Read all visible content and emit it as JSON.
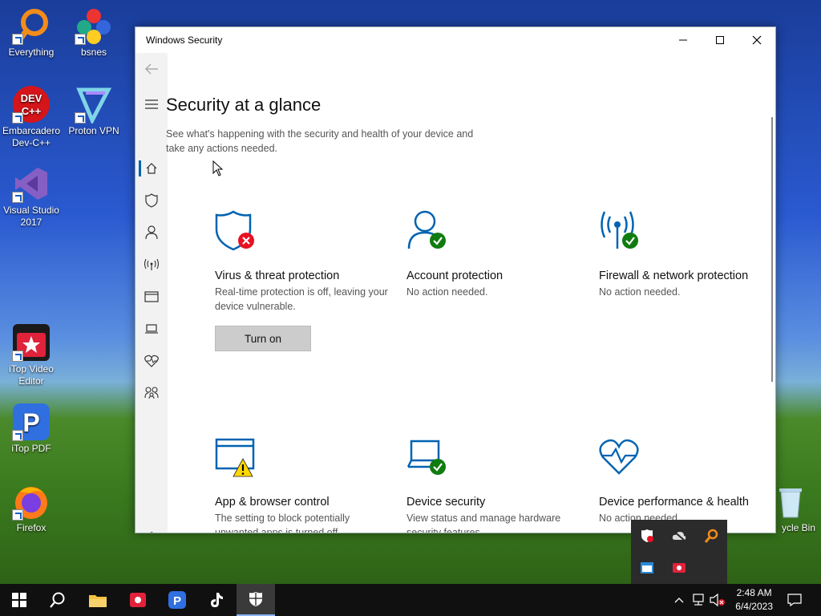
{
  "desktop": {
    "icons": [
      {
        "label": "Everything"
      },
      {
        "label": "bsnes"
      },
      {
        "label": "Embarcadero Dev-C++",
        "badge": "DEV C++"
      },
      {
        "label": "Proton VPN"
      },
      {
        "label": "Visual Studio 2017"
      },
      {
        "label": "iTop Video Editor"
      },
      {
        "label": "iTop PDF"
      },
      {
        "label": "Firefox"
      },
      {
        "label": "Recycle Bin",
        "visible": "ycle Bin"
      }
    ]
  },
  "window": {
    "title": "Windows Security",
    "page_title": "Security at a glance",
    "page_subtitle": "See what's happening with the security and health of your device and take any actions needed.",
    "cards": [
      {
        "title": "Virus & threat protection",
        "desc": "Real-time protection is off, leaving your device vulnerable.",
        "status": "error",
        "button": "Turn on"
      },
      {
        "title": "Account protection",
        "desc": "No action needed.",
        "status": "ok"
      },
      {
        "title": "Firewall & network protection",
        "desc": "No action needed.",
        "status": "ok"
      },
      {
        "title": "App & browser control",
        "desc": "The setting to block potentially unwanted apps is turned off.",
        "status": "warning"
      },
      {
        "title": "Device security",
        "desc": "View status and manage hardware security features",
        "status": "ok"
      },
      {
        "title": "Device performance & health",
        "desc": "No action needed.",
        "status": "none"
      }
    ]
  },
  "taskbar": {
    "time": "2:48 AM",
    "date": "6/4/2023"
  },
  "colors": {
    "accent": "#0063b1",
    "ok": "#107c10",
    "error": "#e81123",
    "warning": "#ffd700"
  }
}
